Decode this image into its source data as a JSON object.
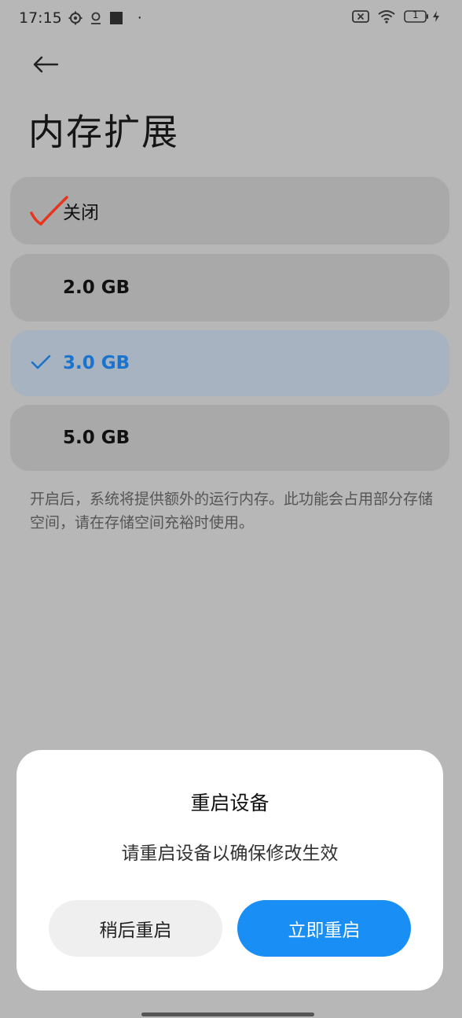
{
  "status_bar": {
    "time": "17:15",
    "dot": "·",
    "icons_left": [
      "settings-gear-icon",
      "location-icon",
      "square-icon"
    ],
    "icons_right": [
      "no-sim-icon",
      "wifi-icon",
      "battery-icon",
      "charging-icon"
    ],
    "battery_text": "1"
  },
  "header": {
    "back_icon": "back-arrow-icon",
    "title": "内存扩展"
  },
  "options": [
    {
      "label": "关闭",
      "selected": false
    },
    {
      "label": "2.0 GB",
      "selected": false
    },
    {
      "label": "3.0 GB",
      "selected": true
    },
    {
      "label": "5.0 GB",
      "selected": false
    }
  ],
  "description": "开启后，系统将提供额外的运行内存。此功能会占用部分存储空间，请在存储空间充裕时使用。",
  "dialog": {
    "title": "重启设备",
    "message": "请重启设备以确保修改生效",
    "later_label": "稍后重启",
    "now_label": "立即重启"
  },
  "colors": {
    "accent": "#198ff5",
    "selected_text": "#1a73cc",
    "annotation_mark": "#e8341f"
  }
}
